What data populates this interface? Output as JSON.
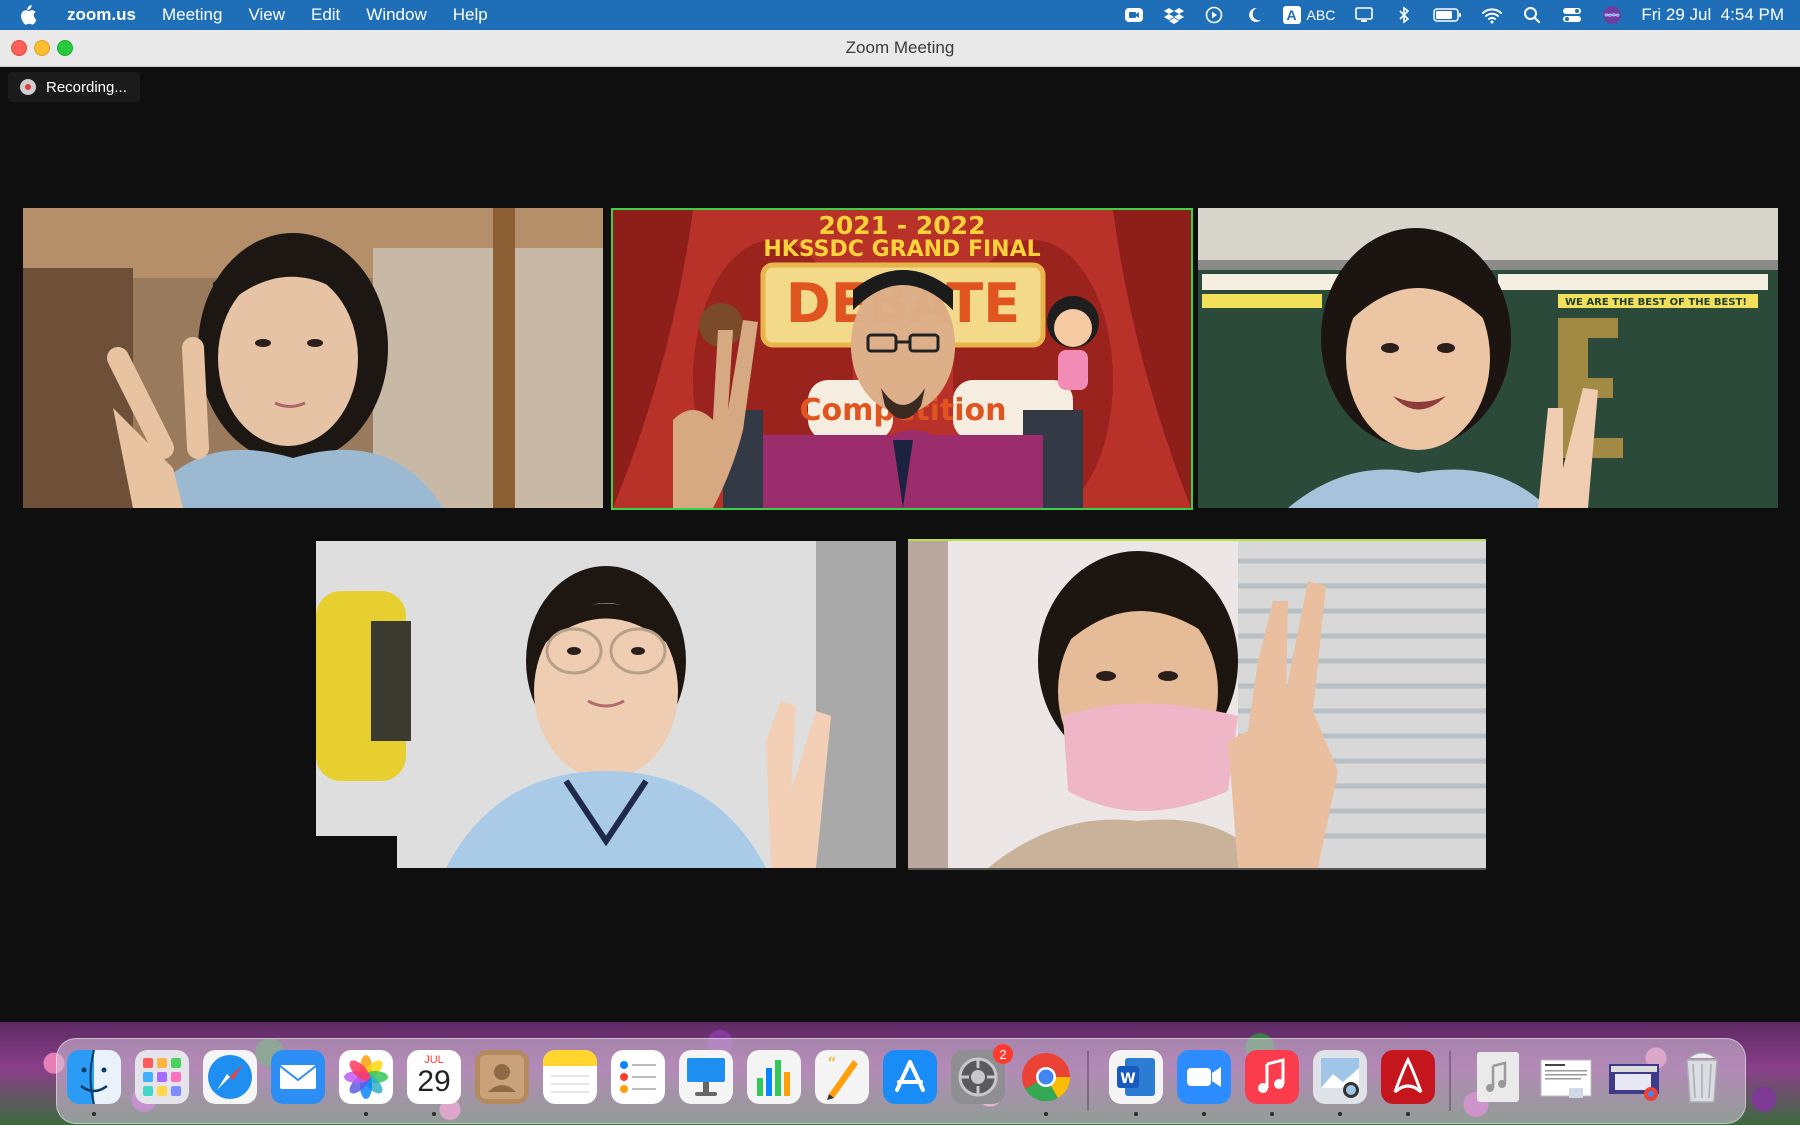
{
  "menubar": {
    "app_name": "zoom.us",
    "menus": [
      "Meeting",
      "View",
      "Edit",
      "Window",
      "Help"
    ],
    "input_source": "ABC",
    "input_letter": "A",
    "datetime": "Fri 29 Jul  4:54 PM"
  },
  "window": {
    "title": "Zoom Meeting"
  },
  "recording": {
    "label": "Recording..."
  },
  "tiles": [
    {
      "id": "participant-1"
    },
    {
      "id": "host-speaker",
      "banner_year": "2021 - 2022",
      "banner_title": "HKSSDC GRAND FINAL",
      "sign_text": "DEBATE",
      "bubble_text": "Competition"
    },
    {
      "id": "participant-3",
      "board_text_1": "WE ARE THE BEST OF THE BEST!"
    },
    {
      "id": "participant-4"
    },
    {
      "id": "participant-5"
    }
  ],
  "dock": {
    "calendar_month": "JUL",
    "calendar_day": "29",
    "settings_badge": "2",
    "apps": [
      "Finder",
      "Launchpad",
      "Safari",
      "Mail",
      "Photos",
      "Calendar",
      "Contacts",
      "Notes",
      "Reminders",
      "Keynote",
      "Numbers",
      "Pages",
      "App Store",
      "System Preferences",
      "Google Chrome",
      "Microsoft Word",
      "Zoom",
      "Music",
      "Preview",
      "Adobe Acrobat",
      "Music File",
      "Document",
      "Screenshot",
      "Trash"
    ]
  },
  "colors": {
    "menubar": "#1f6fb8",
    "active_speaker_border": "#3ecf4a",
    "recording_dot": "#e23b3b",
    "background": "#0f0f0f"
  }
}
